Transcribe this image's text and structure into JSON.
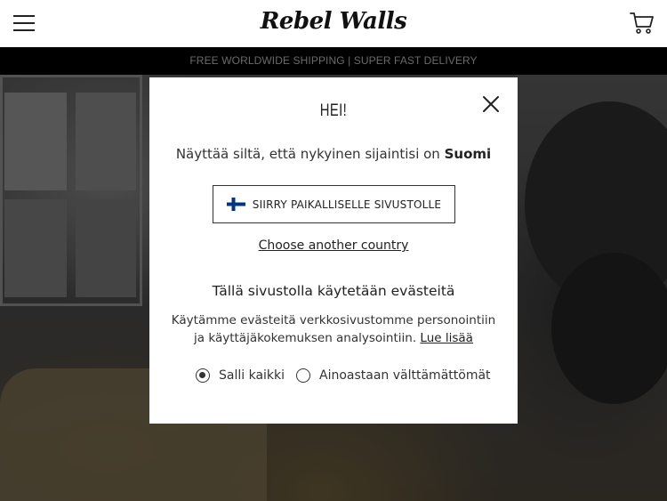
{
  "header": {
    "menu_icon": "hamburger-menu-icon",
    "logo_text": "Rebel Walls",
    "cart_icon": "shopping-cart-icon"
  },
  "shipping_bar": {
    "text": "FREE WORLDWIDE SHIPPING | SUPER FAST DELIVERY"
  },
  "modal": {
    "title": "HEI!",
    "location_prefix": "Näyttää siltä, että nykyinen sijaintisi on",
    "location_country": "Suomi",
    "local_site_button": "SIIRRY PAIKALLISELLE SIVUSTOLLE",
    "flag_icon": "finland-flag-icon",
    "choose_another": "Choose another country",
    "close_icon": "close-icon",
    "cookie_heading": "Tällä sivustolla käytetään evästeitä",
    "cookie_text": "Käytämme evästeitä verkkosivustomme personointiin ja käyttäjäkokemuksen analysointiin.",
    "cookie_link": "Lue lisää",
    "radio_options": [
      {
        "label": "Salli kaikki",
        "checked": true
      },
      {
        "label": "Ainoastaan välttämättömät",
        "checked": false
      }
    ]
  },
  "colors": {
    "flag_blue": "#003580",
    "shipping_bar_bg": "#000000",
    "shipping_bar_text": "#6a6a6a"
  }
}
